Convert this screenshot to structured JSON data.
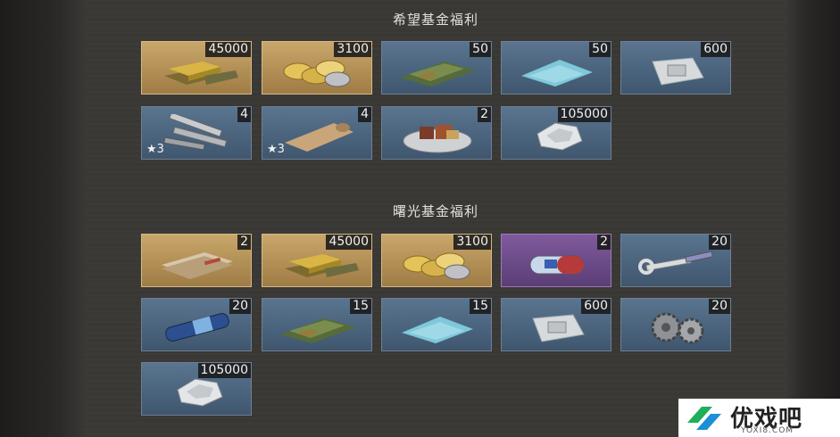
{
  "sections": [
    {
      "title": "希望基金福利",
      "items": [
        {
          "name": "gold-bars",
          "count": "45000",
          "frame": "gold"
        },
        {
          "name": "gold-coins",
          "count": "3100",
          "frame": "gold"
        },
        {
          "name": "camo-wraps",
          "count": "50",
          "frame": "blue"
        },
        {
          "name": "blue-cloth",
          "count": "50",
          "frame": "blue"
        },
        {
          "name": "parts-bag",
          "count": "600",
          "frame": "blue"
        },
        {
          "name": "metal-rods",
          "count": "4",
          "frame": "blue",
          "stars": "★3"
        },
        {
          "name": "blueprint-scroll",
          "count": "4",
          "frame": "blue",
          "stars": "★3"
        },
        {
          "name": "food-plate",
          "count": "2",
          "frame": "blue"
        },
        {
          "name": "silver-ore",
          "count": "105000",
          "frame": "blue"
        }
      ]
    },
    {
      "title": "曙光基金福利",
      "items": [
        {
          "name": "document-packs",
          "count": "2",
          "frame": "gold"
        },
        {
          "name": "gold-bars",
          "count": "45000",
          "frame": "gold"
        },
        {
          "name": "gold-coins",
          "count": "3100",
          "frame": "gold"
        },
        {
          "name": "medicine-capsule",
          "count": "2",
          "frame": "purple"
        },
        {
          "name": "wrench-syringe",
          "count": "20",
          "frame": "blue"
        },
        {
          "name": "battery-cell",
          "count": "20",
          "frame": "blue"
        },
        {
          "name": "camo-wraps",
          "count": "15",
          "frame": "blue"
        },
        {
          "name": "blue-cloth",
          "count": "15",
          "frame": "blue"
        },
        {
          "name": "parts-bag",
          "count": "600",
          "frame": "blue"
        },
        {
          "name": "gears",
          "count": "20",
          "frame": "blue"
        },
        {
          "name": "silver-ore",
          "count": "105000",
          "frame": "blue"
        }
      ]
    }
  ],
  "watermark": {
    "text": "优戏吧",
    "sub": "YOXI8.COM"
  }
}
